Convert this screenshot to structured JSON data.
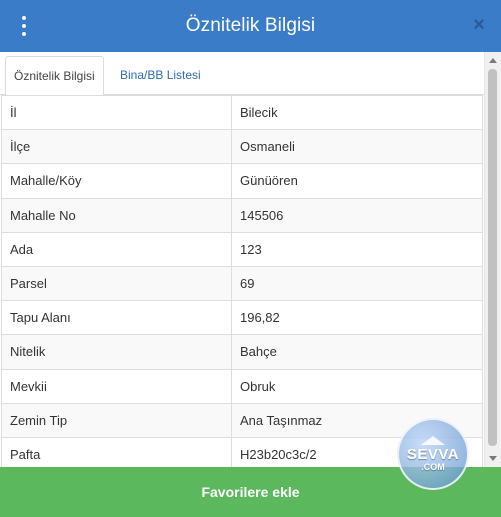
{
  "window": {
    "title": "Öznitelik Bilgisi",
    "menu_icon": "kebab-menu-icon",
    "close_icon": "close-icon",
    "close_glyph": "×"
  },
  "tabs": [
    {
      "label": "Öznitelik Bilgisi",
      "active": true
    },
    {
      "label": "Bina/BB Listesi",
      "active": false
    }
  ],
  "attributes": [
    {
      "key": "İl",
      "value": "Bilecik"
    },
    {
      "key": "İlçe",
      "value": "Osmaneli"
    },
    {
      "key": "Mahalle/Köy",
      "value": "Günüören"
    },
    {
      "key": "Mahalle No",
      "value": "145506"
    },
    {
      "key": "Ada",
      "value": "123"
    },
    {
      "key": "Parsel",
      "value": "69"
    },
    {
      "key": "Tapu Alanı",
      "value": "196,82"
    },
    {
      "key": "Nitelik",
      "value": "Bahçe"
    },
    {
      "key": "Mevkii",
      "value": "Obruk"
    },
    {
      "key": "Zemin Tip",
      "value": "Ana Taşınmaz"
    },
    {
      "key": "Pafta",
      "value": "H23b20c3c/2"
    }
  ],
  "footer": {
    "button_label": "Favorilere ekle"
  },
  "watermark": {
    "main": "SEVVA",
    "sub": ".COM"
  },
  "colors": {
    "header": "#3a7cc7",
    "tab_link": "#2f6db5",
    "button": "#5cb85c"
  }
}
